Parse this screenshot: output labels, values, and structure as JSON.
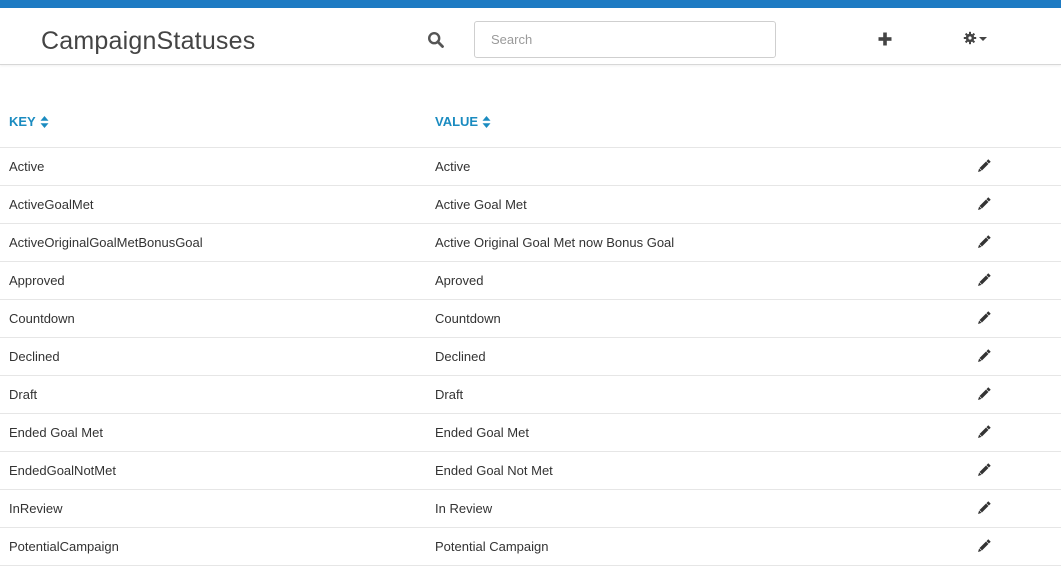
{
  "header": {
    "title": "CampaignStatuses",
    "search_placeholder": "Search",
    "search_value": ""
  },
  "colors": {
    "topbar": "#1e7bc3",
    "header_link": "#1a8bc0",
    "text": "#333333"
  },
  "icons": {
    "search": "search-icon",
    "add": "plus-icon",
    "settings": "gear-icon",
    "sort": "sort-icon",
    "edit": "pencil-icon"
  },
  "table": {
    "columns": [
      {
        "label": "KEY"
      },
      {
        "label": "VALUE"
      }
    ],
    "rows": [
      {
        "key": "Active",
        "value": "Active"
      },
      {
        "key": "ActiveGoalMet",
        "value": "Active Goal Met"
      },
      {
        "key": "ActiveOriginalGoalMetBonusGoal",
        "value": "Active Original Goal Met now Bonus Goal"
      },
      {
        "key": "Approved",
        "value": "Aproved"
      },
      {
        "key": "Countdown",
        "value": "Countdown"
      },
      {
        "key": "Declined",
        "value": "Declined"
      },
      {
        "key": "Draft",
        "value": "Draft"
      },
      {
        "key": "Ended Goal Met",
        "value": "Ended Goal Met"
      },
      {
        "key": "EndedGoalNotMet",
        "value": "Ended Goal Not Met"
      },
      {
        "key": "InReview",
        "value": "In Review"
      },
      {
        "key": "PotentialCampaign",
        "value": "Potential Campaign"
      }
    ]
  }
}
